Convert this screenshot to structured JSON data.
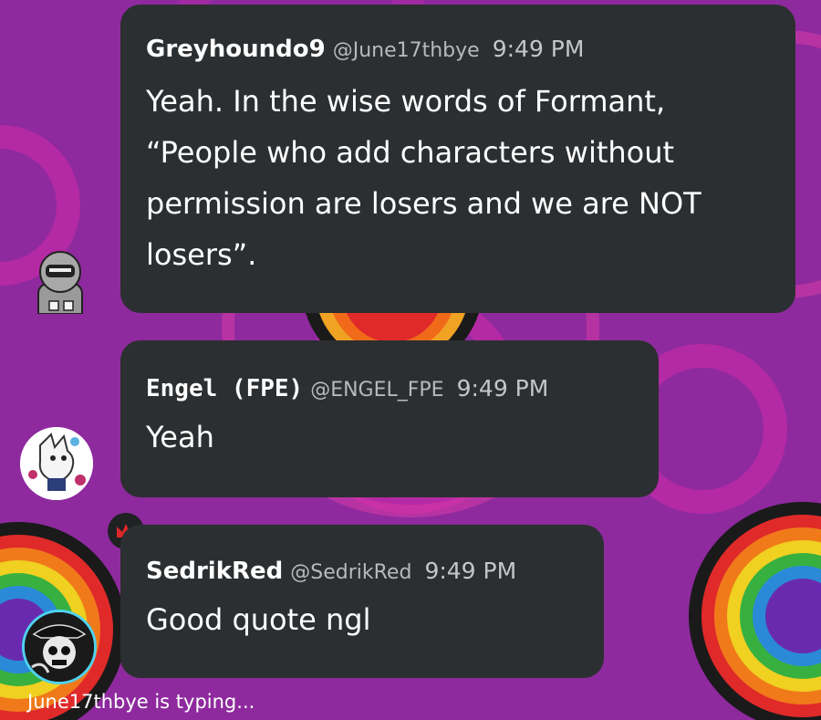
{
  "messages": [
    {
      "username": "Greyhoundo9",
      "handle": "@June17thbye",
      "time": "9:49 PM",
      "lines": [
        "Yeah. In the wise words of Formant,",
        "“People who add characters without",
        "permission are losers and we are NOT",
        "losers”."
      ],
      "avatar_icon": "hooded-figure-icon"
    },
    {
      "username": "Engel (FPE)",
      "handle": "@ENGEL_FPE",
      "time": "9:49 PM",
      "lines": [
        "Yeah"
      ],
      "avatar_icon": "white-creature-avatar-icon"
    },
    {
      "username": "SedrikRed",
      "handle": "@SedrikRed",
      "time": "9:49 PM",
      "lines": [
        "Good quote ngl"
      ],
      "avatar_icon": "skull-avatar-icon",
      "badge_icon": "crown-icon"
    }
  ],
  "typing_indicator": "June17thbye is typing...",
  "colors": {
    "background": "#8e2a9e",
    "bubble": "#2c2f31",
    "crown": "#e0262a",
    "avatar_ring": "#4fd2f0"
  }
}
